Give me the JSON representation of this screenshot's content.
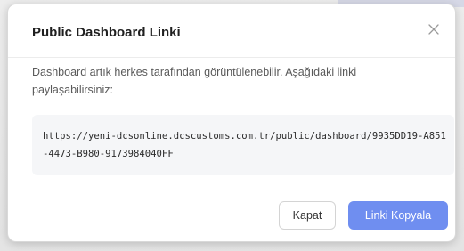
{
  "modal": {
    "title": "Public Dashboard Linki",
    "close_icon": "close-icon",
    "description": "Dashboard artık herkes tarafından görüntülenebilir. Aşağıdaki linki paylaşabilirsiniz:",
    "url": "https://yeni-dcsonline.dcscustoms.com.tr/public/dashboard/9935DD19-A851-4473-B980-9173984040FF",
    "buttons": {
      "close_label": "Kapat",
      "copy_label": "Linki Kopyala"
    }
  },
  "colors": {
    "primary": "#6f8ef0",
    "title": "#1f1f1f",
    "text": "#5a5a5a",
    "url_bg": "#f5f6f8"
  }
}
